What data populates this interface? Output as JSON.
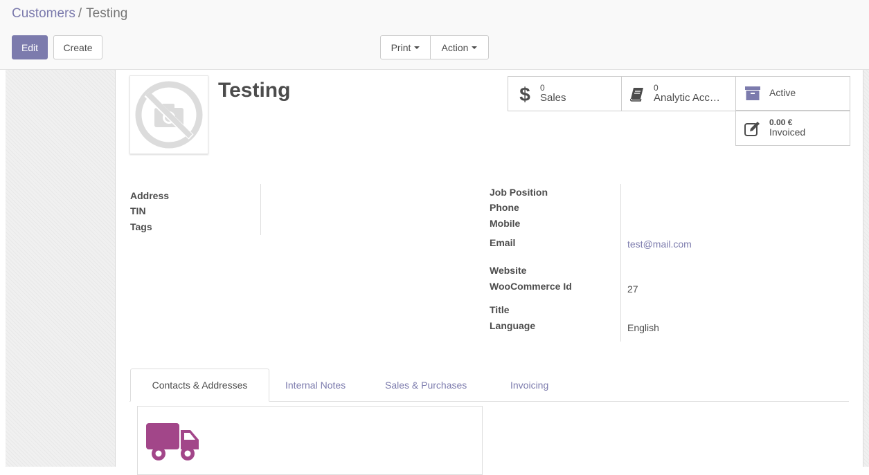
{
  "breadcrumb": {
    "parent": "Customers",
    "separator": "/",
    "current": "Testing"
  },
  "toolbar": {
    "edit_label": "Edit",
    "create_label": "Create",
    "print_label": "Print",
    "action_label": "Action"
  },
  "record": {
    "name": "Testing"
  },
  "smart_buttons": {
    "sales": {
      "value": "0",
      "label": "Sales",
      "icon": "dollar-icon"
    },
    "analytic": {
      "value": "0",
      "label": "Analytic Acc…",
      "icon": "book-icon"
    },
    "active": {
      "label": "Active",
      "icon": "archive-icon"
    },
    "invoiced": {
      "value": "0.00 €",
      "label": "Invoiced",
      "icon": "pencil-square-icon"
    }
  },
  "fields_left": {
    "address_label": "Address",
    "tin_label": "TIN",
    "tags_label": "Tags"
  },
  "fields_right": {
    "job_position_label": "Job Position",
    "phone_label": "Phone",
    "mobile_label": "Mobile",
    "email_label": "Email",
    "email_value": "test@mail.com",
    "website_label": "Website",
    "woocommerce_label": "WooCommerce Id",
    "woocommerce_value": "27",
    "title_label": "Title",
    "language_label": "Language",
    "language_value": "English"
  },
  "tabs": [
    {
      "label": "Contacts & Addresses"
    },
    {
      "label": "Internal Notes"
    },
    {
      "label": "Sales & Purchases"
    },
    {
      "label": "Invoicing"
    }
  ],
  "colors": {
    "primary": "#7c7bad",
    "truck": "#a24689"
  },
  "icons": {
    "avatar_placeholder": "no-camera-icon",
    "contact_card": "truck-icon"
  }
}
